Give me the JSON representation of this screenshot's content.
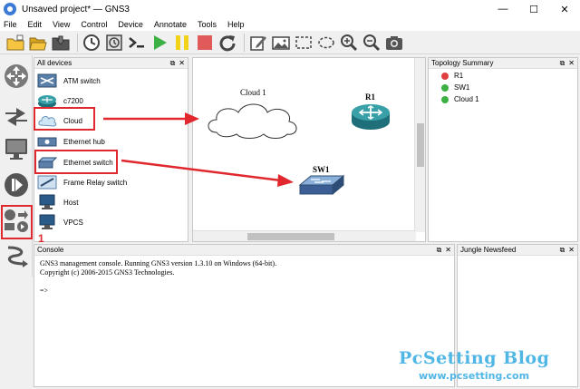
{
  "window": {
    "title": "Unsaved project* — GNS3",
    "minimize": "—",
    "maximize": "☐",
    "close": "✕"
  },
  "menu": [
    "File",
    "Edit",
    "View",
    "Control",
    "Device",
    "Annotate",
    "Tools",
    "Help"
  ],
  "toolbar_icons": [
    "new-project-icon",
    "open-project-icon",
    "save-project-icon",
    "clock-icon",
    "snapshot-icon",
    "console-icon",
    "start-icon",
    "pause-icon",
    "stop-icon",
    "reload-icon",
    "note-icon",
    "image-icon",
    "rectangle-icon",
    "ellipse-icon",
    "zoom-in-icon",
    "zoom-out-icon",
    "screenshot-icon"
  ],
  "devices_panel": {
    "title": "All devices",
    "controls": [
      "⧉",
      "✕"
    ],
    "items": [
      "ATM switch",
      "c7200",
      "Cloud",
      "Ethernet hub",
      "Ethernet switch",
      "Frame Relay switch",
      "Host",
      "VPCS"
    ]
  },
  "canvas": {
    "nodes": {
      "cloud": "Cloud 1",
      "router": "R1",
      "switch": "SW1"
    }
  },
  "topology": {
    "title": "Topology Summary",
    "controls": [
      "⧉",
      "✕"
    ],
    "items": [
      {
        "label": "R1",
        "status_color": "#e04040"
      },
      {
        "label": "SW1",
        "status_color": "#3cb043"
      },
      {
        "label": "Cloud 1",
        "status_color": "#3cb043"
      }
    ]
  },
  "console_panel": {
    "title": "Console",
    "controls": [
      "⧉",
      "✕"
    ],
    "lines": [
      "GNS3 management console. Running GNS3 version 1.3.10 on Windows (64-bit).",
      "Copyright (c) 2006-2015 GNS3 Technologies.",
      "",
      "=>"
    ]
  },
  "jungle_panel": {
    "title": "Jungle Newsfeed",
    "controls": [
      "⧉",
      "✕"
    ]
  },
  "annotation": {
    "number": "1",
    "color": "#e0282e"
  },
  "watermark": {
    "title": "PcSetting Blog",
    "url": "www.pcsetting.com",
    "color": "#4fb6e6"
  }
}
